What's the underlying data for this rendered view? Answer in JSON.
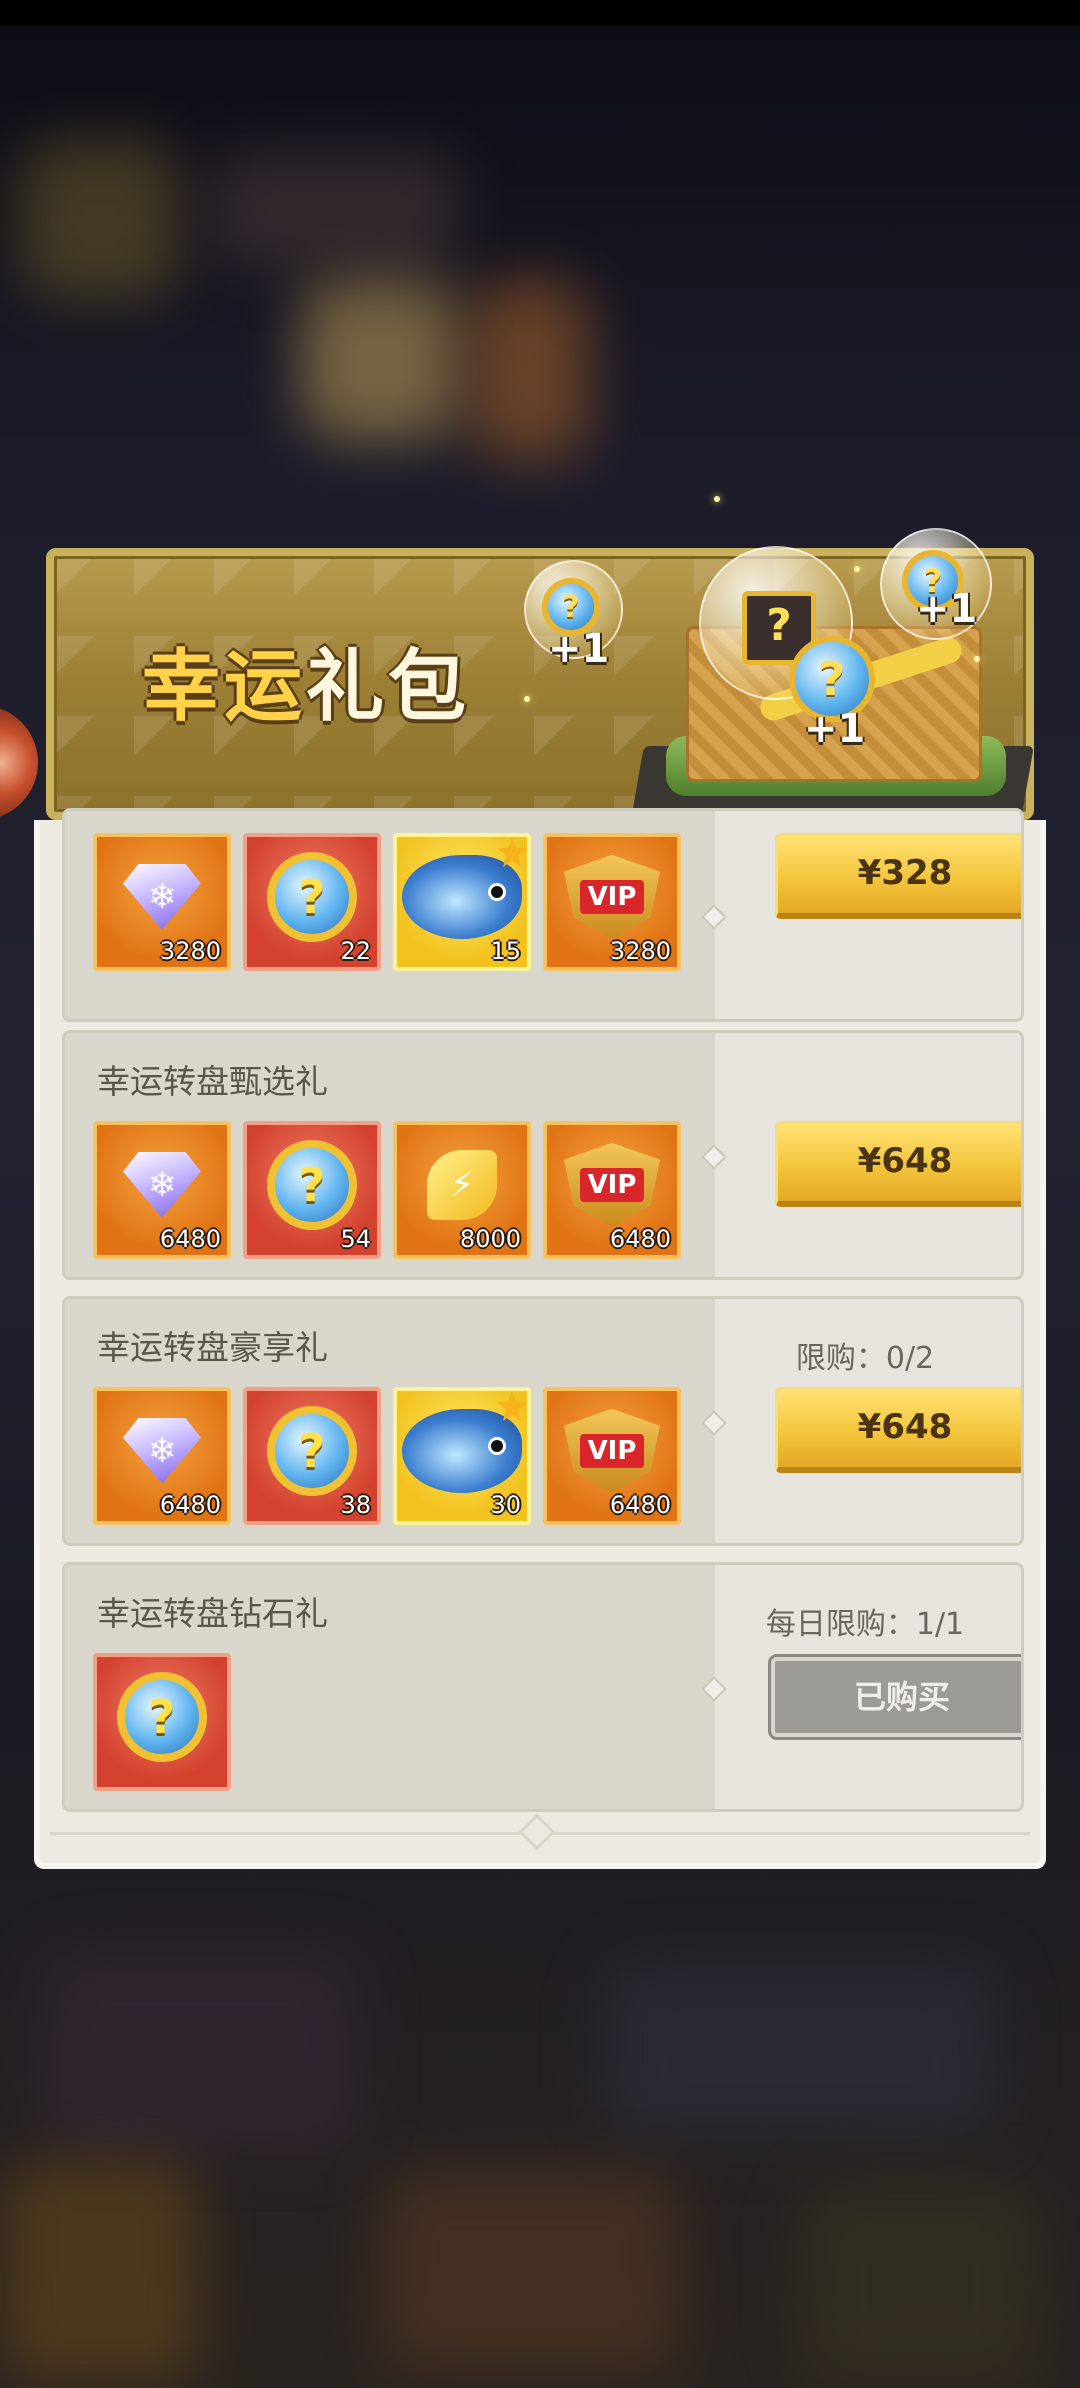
{
  "panel": {
    "title_highlight": "幸运",
    "title_rest": "礼包",
    "plus_badges": [
      "+1",
      "+1",
      "+1"
    ],
    "mystery_symbol": "?"
  },
  "packs": [
    {
      "name": "",
      "limit": "",
      "button": "¥328",
      "button_state": "price",
      "items": [
        {
          "icon": "diamond-icon",
          "count": "3280"
        },
        {
          "icon": "lucky-coin-icon",
          "count": "22"
        },
        {
          "icon": "fish-pet-icon",
          "count": "15"
        },
        {
          "icon": "vip-badge-icon",
          "count": "3280"
        }
      ]
    },
    {
      "name": "幸运转盘甄选礼",
      "limit": "",
      "button": "¥648",
      "button_state": "price",
      "items": [
        {
          "icon": "diamond-icon",
          "count": "6480"
        },
        {
          "icon": "lucky-coin-icon",
          "count": "54"
        },
        {
          "icon": "gold-leaf-icon",
          "count": "8000"
        },
        {
          "icon": "vip-badge-icon",
          "count": "6480"
        }
      ]
    },
    {
      "name": "幸运转盘豪享礼",
      "limit": "限购：0/2",
      "button": "¥648",
      "button_state": "price",
      "items": [
        {
          "icon": "diamond-icon",
          "count": "6480"
        },
        {
          "icon": "lucky-coin-icon",
          "count": "38"
        },
        {
          "icon": "fish-pet-icon",
          "count": "30"
        },
        {
          "icon": "vip-badge-icon",
          "count": "6480"
        }
      ]
    },
    {
      "name": "幸运转盘钻石礼",
      "limit": "每日限购：1/1",
      "button": "已购买",
      "button_state": "purchased",
      "items": [
        {
          "icon": "lucky-coin-icon",
          "count": ""
        }
      ]
    }
  ],
  "icon_text": {
    "question": "?",
    "vip": "VIP",
    "snow": "❄",
    "bolt": "⚡"
  },
  "colors": {
    "button_gold": "#f4c53d",
    "button_disabled": "#9c9a94",
    "title_gold": "#ffd24a"
  }
}
